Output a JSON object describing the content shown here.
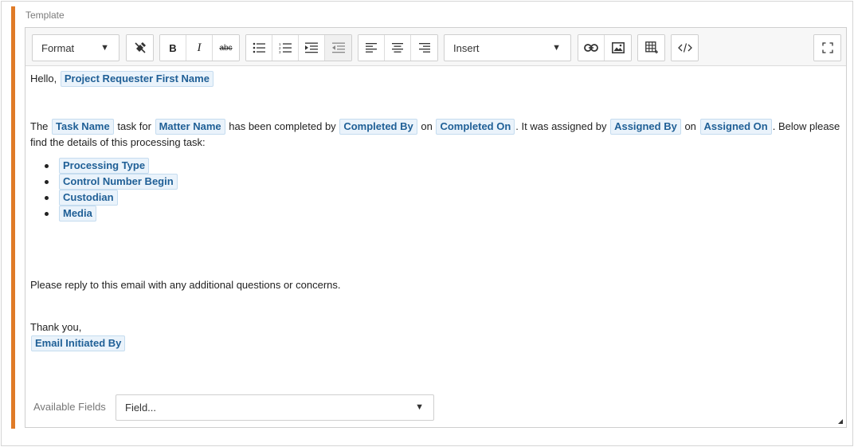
{
  "section_label": "Template",
  "toolbar": {
    "format_label": "Format",
    "insert_label": "Insert",
    "bold_label": "B",
    "italic_label": "I",
    "strike_label": "abc"
  },
  "content": {
    "greeting": "Hello,",
    "greeting_field": "Project Requester First Name",
    "sentence": {
      "t1": "The",
      "f_task": "Task Name",
      "t2": "task for",
      "f_matter": "Matter Name",
      "t3": "has been completed by",
      "f_completed_by": "Completed By",
      "t4": "on",
      "f_completed_on": "Completed On",
      "t5": ". It was assigned by",
      "f_assigned_by": "Assigned By",
      "t6": "on",
      "f_assigned_on": "Assigned On",
      "t7": ". Below please find the details of this processing task:"
    },
    "list_fields": [
      "Processing Type",
      "Control Number Begin",
      "Custodian",
      "Media"
    ],
    "reply_text": "Please reply to this email with any additional questions or concerns.",
    "closing": "Thank you,",
    "signature_field": "Email Initiated By"
  },
  "available_fields": {
    "label": "Available Fields",
    "placeholder": "Field..."
  },
  "icons": [
    "clear-format-icon",
    "bullet-list-icon",
    "numbered-list-icon",
    "indent-icon",
    "outdent-icon",
    "align-left-icon",
    "align-center-icon",
    "align-right-icon",
    "link-icon",
    "image-icon",
    "table-icon",
    "code-icon",
    "fullscreen-icon"
  ],
  "colors": {
    "accent": "#e07b27",
    "chip_bg": "#eaf3fb",
    "chip_text": "#1f5f96"
  }
}
